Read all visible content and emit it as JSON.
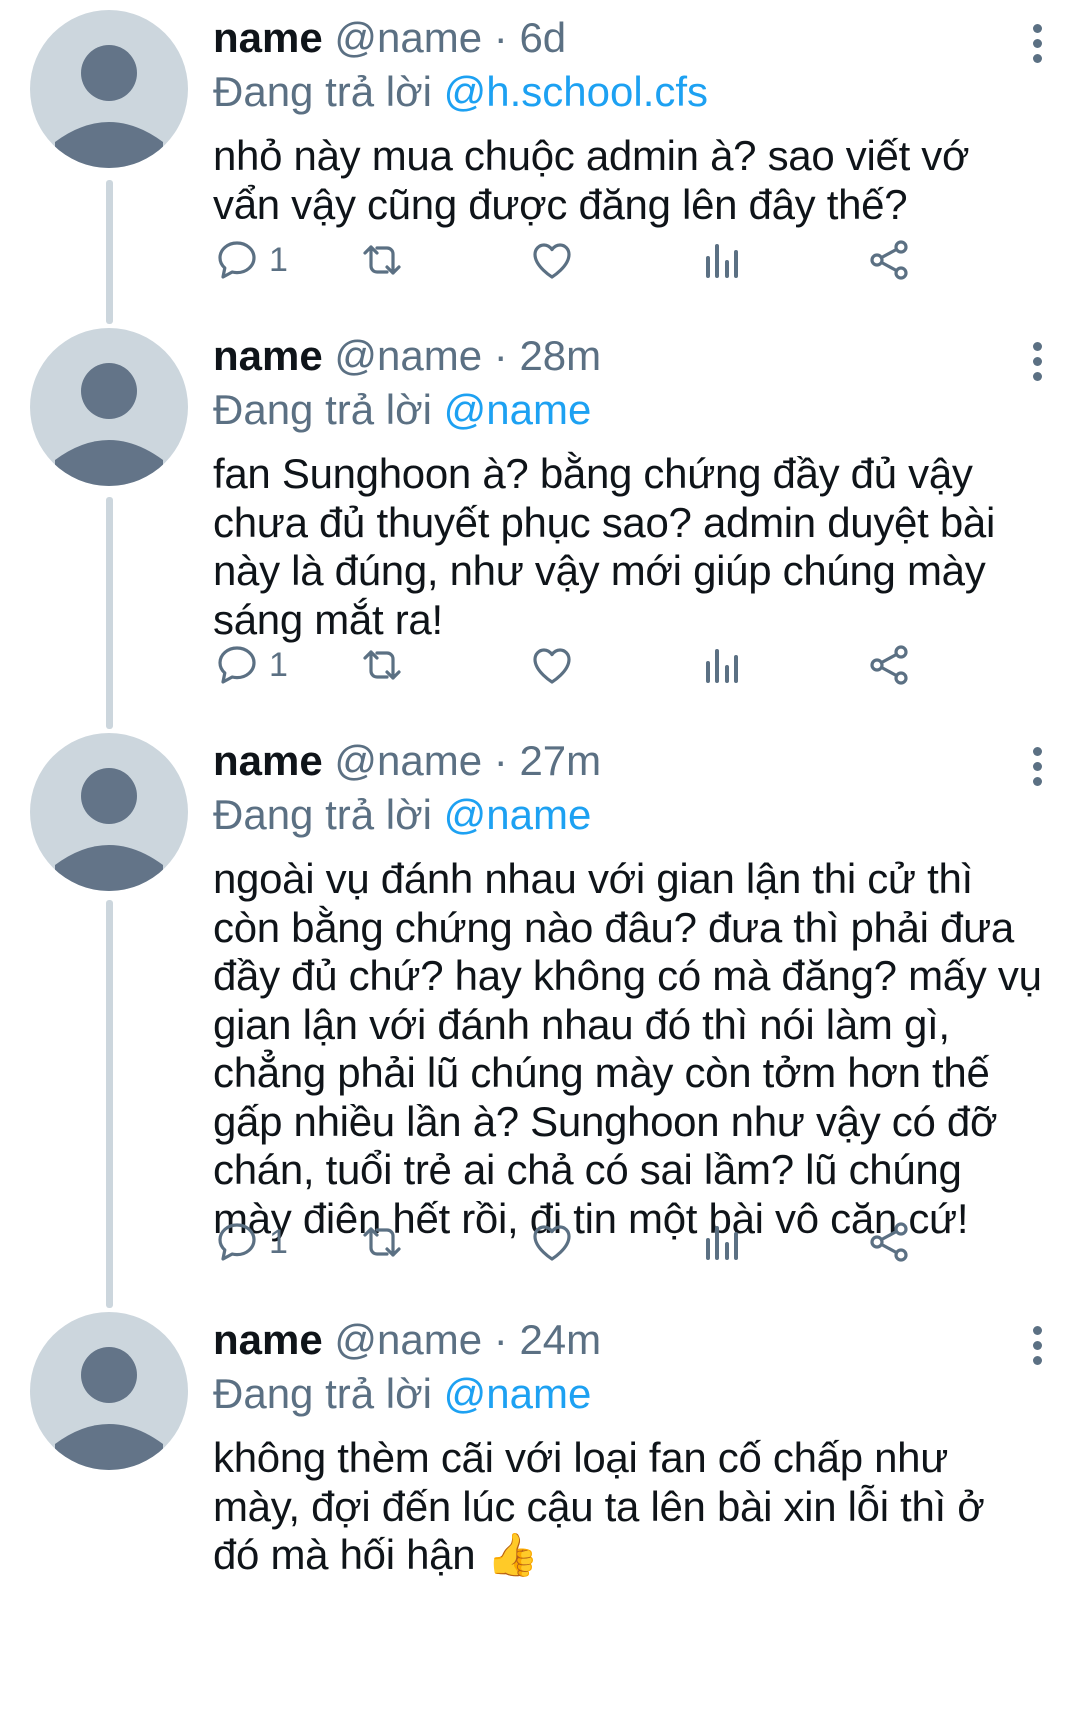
{
  "tweets": [
    {
      "name": "name",
      "handle": "@name",
      "time": "6d",
      "replying_label": "Đang trả lời",
      "replying_to": "@h.school.cfs",
      "text": "nhỏ này mua chuộc admin à? sao viết vớ\nvẩn vậy cũng được đăng lên đây thế?",
      "reply_count": "1"
    },
    {
      "name": "name",
      "handle": "@name",
      "time": "28m",
      "replying_label": "Đang trả lời",
      "replying_to": "@name",
      "text": "fan Sunghoon à? bằng chứng đầy đủ vậy\nchưa đủ thuyết phục sao? admin duyệt bài\nnày là đúng, như vậy mới giúp chúng mày\nsáng mắt ra!",
      "reply_count": "1"
    },
    {
      "name": "name",
      "handle": "@name",
      "time": "27m",
      "replying_label": "Đang trả lời",
      "replying_to": "@name",
      "text": "ngoài vụ đánh nhau với gian lận thi cử thì\ncòn bằng chứng nào đâu? đưa thì phải đưa\nđầy đủ chứ? hay không có mà đăng? mấy vụ\ngian lận với đánh nhau đó thì nói làm gì,\nchẳng phải lũ chúng mày còn tởm hơn thế\ngấp nhiều lần à? Sunghoon như vậy có đỡ\nchán, tuổi trẻ ai chả có sai lầm? lũ chúng\nmày điên hết rồi, đi tin một bài vô căn cứ!",
      "reply_count": "1"
    },
    {
      "name": "name",
      "handle": "@name",
      "time": "24m",
      "replying_label": "Đang trả lời",
      "replying_to": "@name",
      "text": "không thèm cãi với loại fan cố chấp như\nmày, đợi đến lúc cậu ta lên bài xin lỗi thì ở\nđó mà hối hận 👍"
    }
  ],
  "icons": {
    "reply": "reply-icon",
    "retweet": "retweet-icon",
    "like": "like-icon",
    "analytics": "analytics-icon",
    "share": "share-icon",
    "more": "more-options-icon"
  },
  "colors": {
    "accent": "#1da1f2",
    "muted": "#5b7083",
    "avatar_bg": "#ccd6dd",
    "avatar_fg": "#637488"
  }
}
